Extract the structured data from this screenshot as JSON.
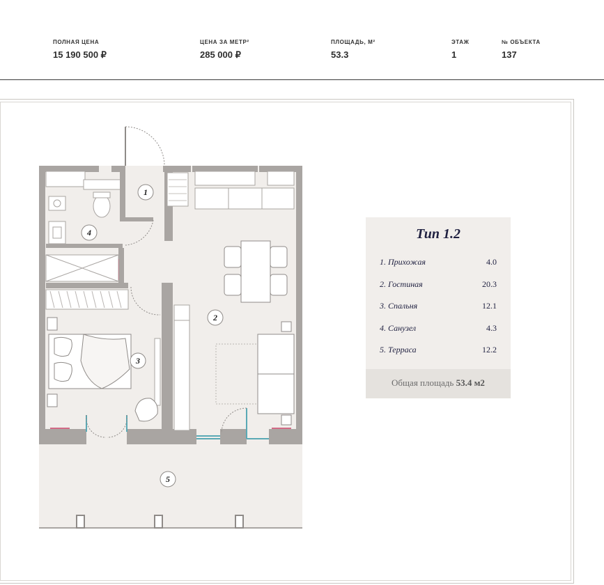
{
  "specs": {
    "price": {
      "label": "ПОЛНАЯ ЦЕНА",
      "value": "15 190 500 ₽"
    },
    "price_per_meter": {
      "label": "ЦЕНА ЗА МЕТР²",
      "value": "285 000 ₽"
    },
    "area": {
      "label": "ПЛОЩАДЬ, М²",
      "value": "53.3"
    },
    "floor": {
      "label": "ЭТАЖ",
      "value": "1"
    },
    "object_number": {
      "label": "№ ОБЪЕКТА",
      "value": "137"
    }
  },
  "legend": {
    "title": "Тип 1.2",
    "rooms": [
      {
        "name": "1. Прихожая",
        "area": "4.0"
      },
      {
        "name": "2. Гостиная",
        "area": "20.3"
      },
      {
        "name": "3. Спальня",
        "area": "12.1"
      },
      {
        "name": "4. Санузел",
        "area": "4.3"
      },
      {
        "name": "5. Терраса",
        "area": "12.2"
      }
    ],
    "total_label": "Общая площадь",
    "total_value": "53.4 м2"
  },
  "plan_labels": [
    "1",
    "2",
    "3",
    "4",
    "5"
  ],
  "colors": {
    "wall": "#a9a5a2",
    "floor": "#f1eeeb",
    "window": "#5aa9b5",
    "accent": "#d26a86",
    "legend_title": "#1f2040"
  }
}
